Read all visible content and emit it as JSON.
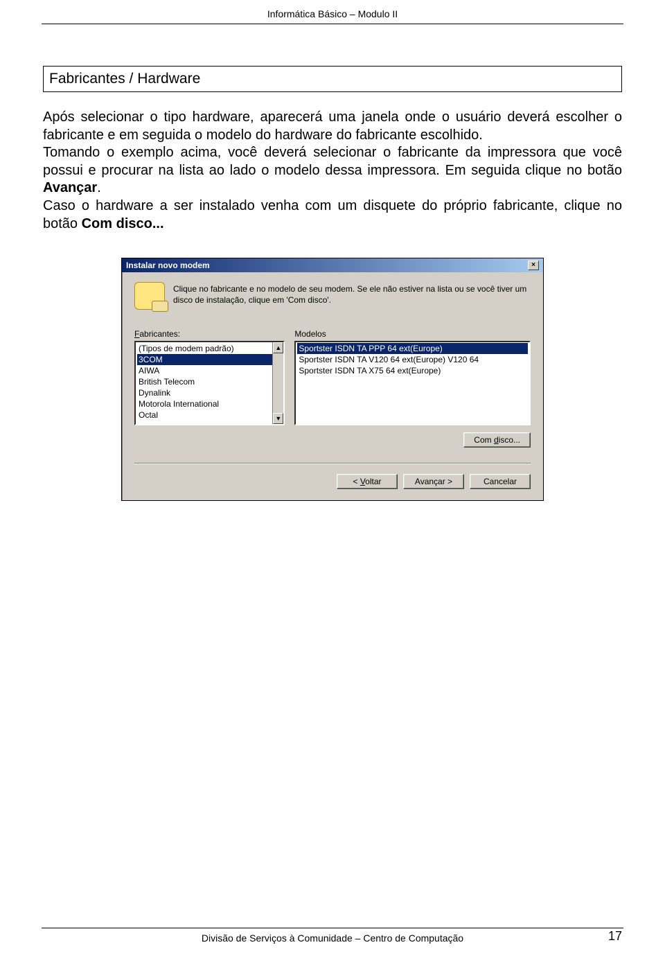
{
  "header": "Informática Básico – Modulo II",
  "section_title": "Fabricantes / Hardware",
  "paragraphs": {
    "p1": "Após selecionar o tipo hardware, aparecerá uma janela onde o usuário deverá escolher o fabricante e em seguida o modelo do hardware do fabricante escolhido.",
    "p2a": "Tomando o exemplo acima, você deverá selecionar o fabricante da impressora que você possui e procurar na lista ao lado o modelo dessa impressora. Em seguida clique no botão ",
    "p2b": "Avançar",
    "p2c": ".",
    "p3a": "Caso o hardware a ser instalado venha com um disquete do próprio fabricante, clique no botão ",
    "p3b": "Com disco...",
    "p3c": ""
  },
  "dialog": {
    "title": "Instalar novo modem",
    "instruction": "Clique no fabricante e no modelo de seu modem. Se ele não estiver na lista ou se você tiver um disco de instalação, clique em 'Com disco'.",
    "left_label_pre": "F",
    "left_label_post": "abricantes:",
    "right_label": "Modelos",
    "fabricantes": [
      "(Tipos de modem padrão)",
      "3COM",
      "AIWA",
      "British Telecom",
      "Dynalink",
      "Motorola International",
      "Octal"
    ],
    "fabricantes_selected_index": 1,
    "modelos": [
      "Sportster ISDN TA PPP 64 ext(Europe)",
      "Sportster ISDN TA V120 64 ext(Europe) V120 64",
      "Sportster ISDN TA X75 64 ext(Europe)"
    ],
    "modelos_selected_index": 0,
    "btn_disk_pre": "Com ",
    "btn_disk_u": "d",
    "btn_disk_post": "isco...",
    "btn_back_pre": "< ",
    "btn_back_u": "V",
    "btn_back_post": "oltar",
    "btn_next": "Avançar >",
    "btn_cancel": "Cancelar",
    "close_x": "×",
    "scroll_up": "▲",
    "scroll_down": "▼"
  },
  "footer": "Divisão de Serviços à Comunidade – Centro de Computação",
  "page_number": "17"
}
